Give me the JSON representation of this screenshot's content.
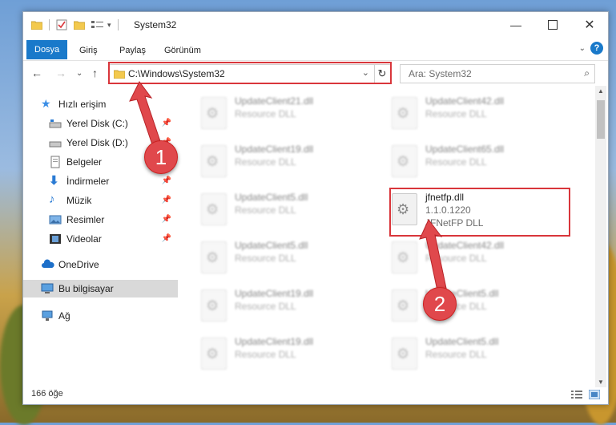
{
  "window": {
    "title": "System32"
  },
  "ribbon": {
    "tabs": [
      "Dosya",
      "Giriş",
      "Paylaş",
      "Görünüm"
    ],
    "active_tab": "Dosya",
    "help": "?"
  },
  "nav": {
    "address": "C:\\Windows\\System32",
    "search_placeholder": "Ara: System32"
  },
  "sidebar": {
    "items": [
      {
        "label": "Hızlı erişim",
        "icon": "star-icon"
      },
      {
        "label": "Yerel Disk (C:)",
        "icon": "drive-icon",
        "pinned": true
      },
      {
        "label": "Yerel Disk (D:)",
        "icon": "drive-icon",
        "pinned": true
      },
      {
        "label": "Belgeler",
        "icon": "documents-icon",
        "pinned": true
      },
      {
        "label": "İndirmeler",
        "icon": "download-icon",
        "pinned": true
      },
      {
        "label": "Müzik",
        "icon": "music-icon",
        "pinned": true
      },
      {
        "label": "Resimler",
        "icon": "pictures-icon",
        "pinned": true
      },
      {
        "label": "Videolar",
        "icon": "video-icon",
        "pinned": true
      },
      {
        "label": "OneDrive",
        "icon": "cloud-icon"
      },
      {
        "label": "Bu bilgisayar",
        "icon": "computer-icon",
        "selected": true
      },
      {
        "label": "Ağ",
        "icon": "network-icon"
      }
    ]
  },
  "files": {
    "col1": [
      {
        "name": "UpdateClient21.dll",
        "desc": "Resource DLL"
      },
      {
        "name": "UpdateClient19.dll",
        "desc": "Resource DLL"
      },
      {
        "name": "UpdateClient5.dll",
        "desc": "Resource DLL"
      },
      {
        "name": "UpdateClient5.dll",
        "desc": "Resource DLL"
      },
      {
        "name": "UpdateClient19.dll",
        "desc": "Resource DLL"
      },
      {
        "name": "UpdateClient19.dll",
        "desc": "Resource DLL"
      }
    ],
    "col2_top": [
      {
        "name": "UpdateClient42.dll",
        "desc": "Resource DLL"
      },
      {
        "name": "UpdateClient65.dll",
        "desc": "Resource DLL"
      }
    ],
    "highlight": {
      "name": "jfnetfp.dll",
      "version": "1.1.0.1220",
      "desc": "JFNetFP DLL"
    },
    "col2_bottom": [
      {
        "name": "UpdateClient42.dll",
        "desc": "Resource DLL"
      },
      {
        "name": "UpdateClient5.dll",
        "desc": "Resource DLL"
      },
      {
        "name": "UpdateClient5.dll",
        "desc": "Resource DLL"
      }
    ]
  },
  "status": {
    "count": "166 öğe"
  },
  "annotations": {
    "step1": "1",
    "step2": "2",
    "color": "#d9363b"
  }
}
